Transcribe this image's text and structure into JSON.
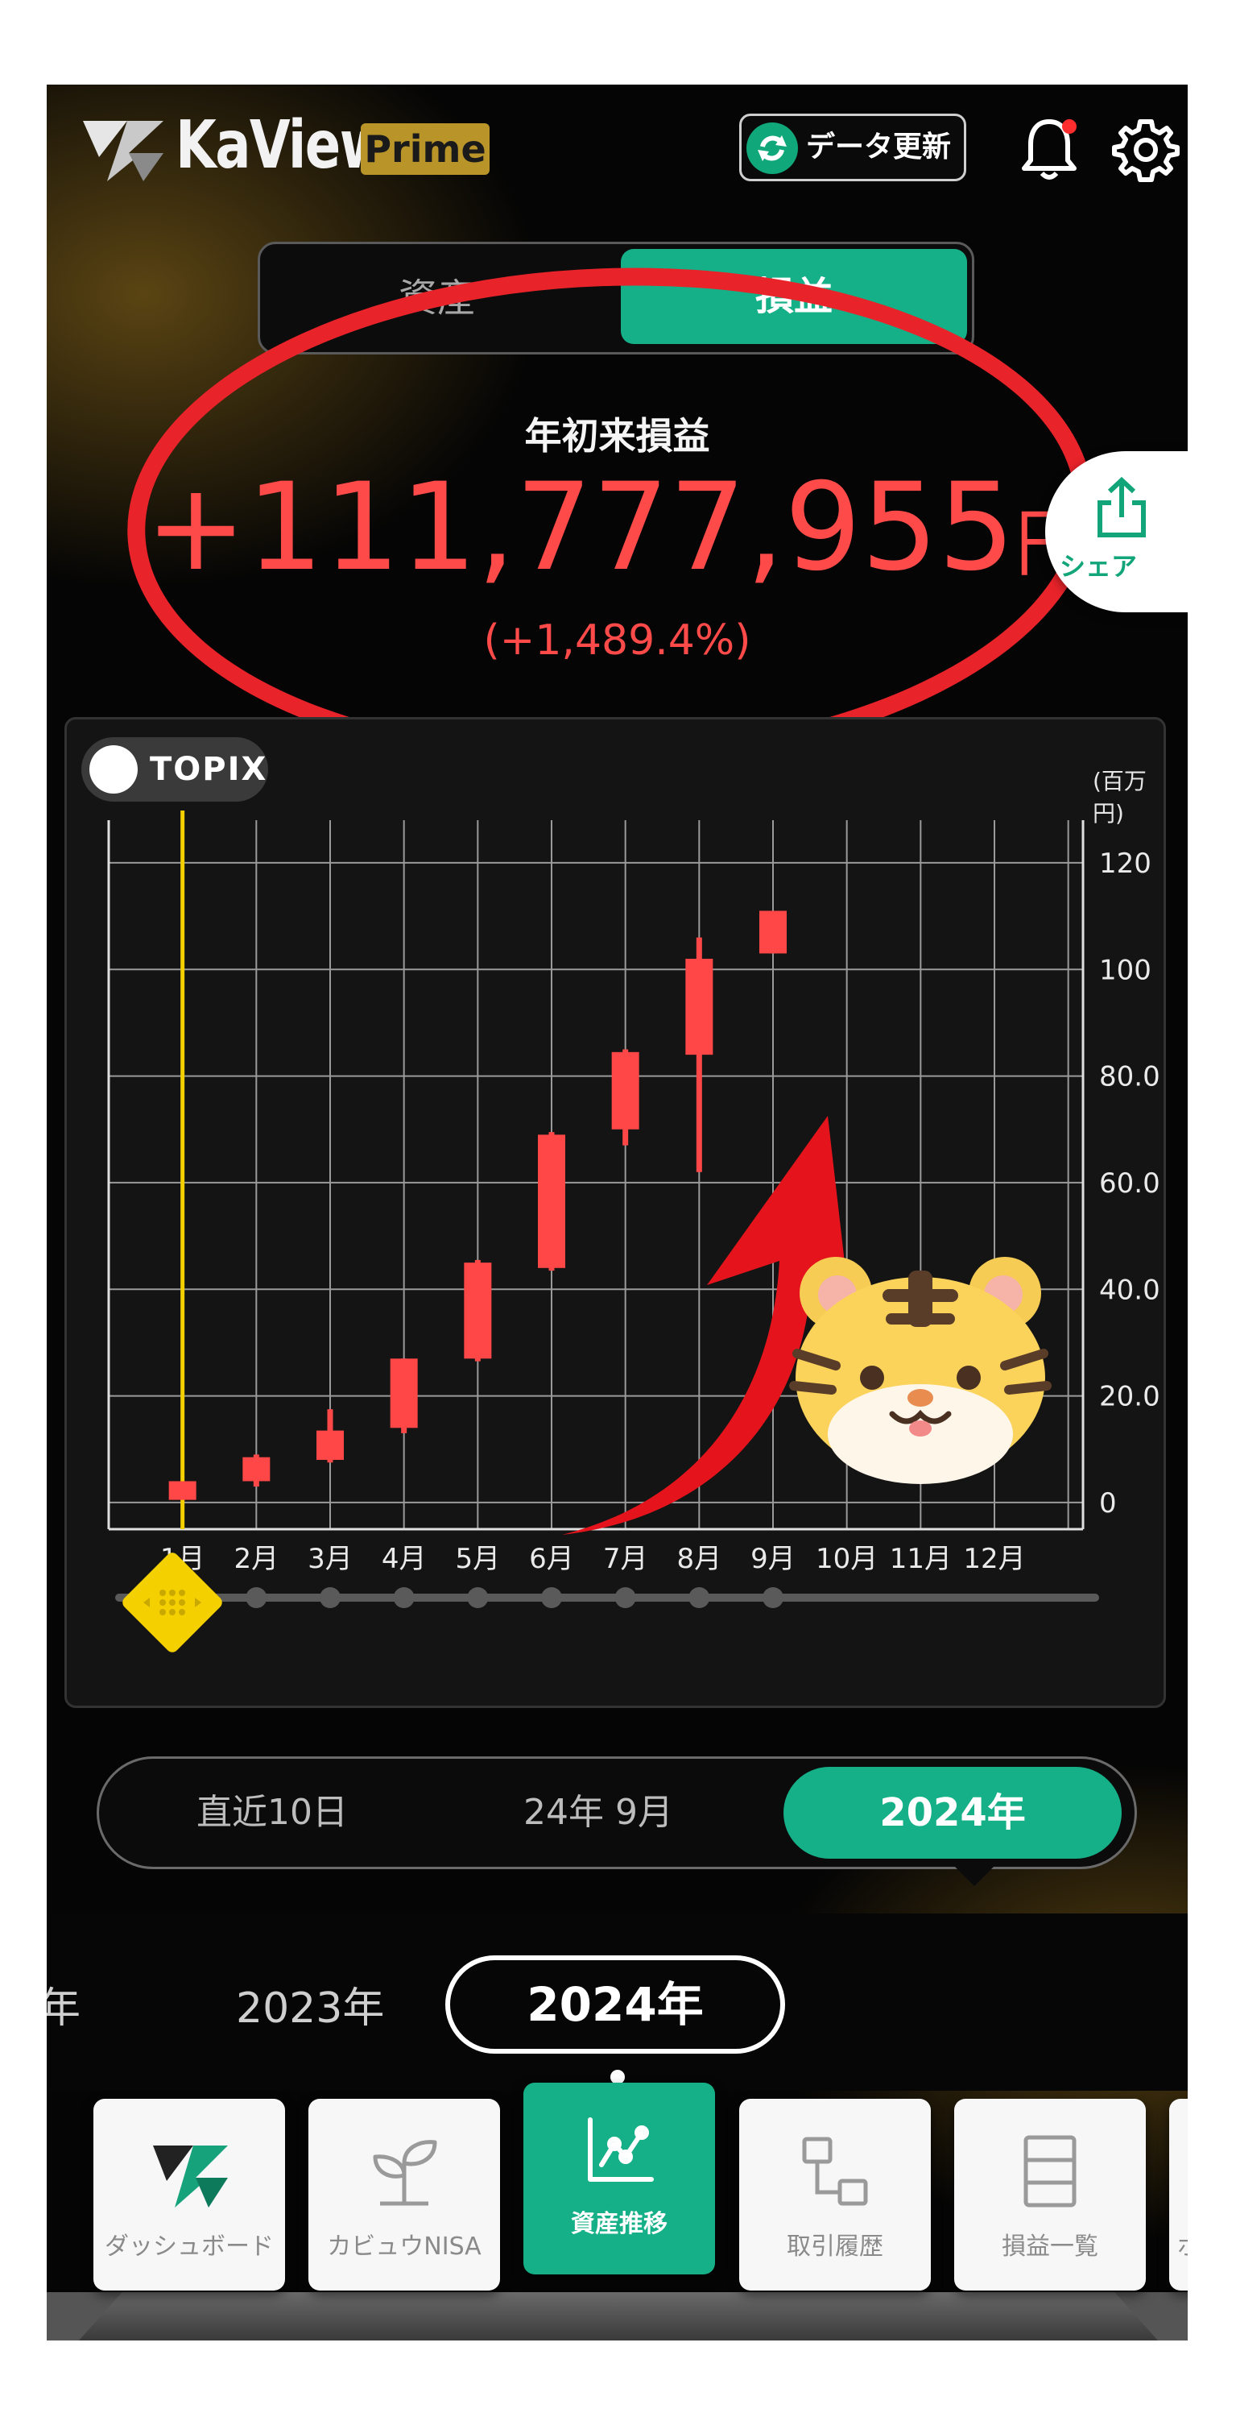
{
  "header": {
    "logo_text": "KaView",
    "logo_badge": "Prime",
    "update_label": "データ更新"
  },
  "tabs_top": {
    "asset": "資産",
    "pl": "損益",
    "active": "pl"
  },
  "summary": {
    "title": "年初来損益",
    "value": "+111,777,955",
    "currency": "円",
    "percent": "(+1,489.4%)"
  },
  "share": {
    "label": "シェア"
  },
  "chart": {
    "topix_label": "TOPIX",
    "unit_label": "(百万円)",
    "cursor_month_index": 1
  },
  "chart_data": {
    "type": "candlestick",
    "categories": [
      "1月",
      "2月",
      "3月",
      "4月",
      "5月",
      "6月",
      "7月",
      "8月",
      "9月",
      "10月",
      "11月",
      "12月"
    ],
    "y_ticks": [
      "0",
      "20.0",
      "40.0",
      "60.0",
      "80.0",
      "100",
      "120"
    ],
    "ylim": [
      -5,
      128
    ],
    "candles": [
      {
        "x": "1月",
        "open": 0.5,
        "close": 4,
        "low": 0.5,
        "high": 4
      },
      {
        "x": "2月",
        "open": 4,
        "close": 8.5,
        "low": 3,
        "high": 9
      },
      {
        "x": "3月",
        "open": 8,
        "close": 13.5,
        "low": 7.5,
        "high": 17.5
      },
      {
        "x": "4月",
        "open": 14,
        "close": 27,
        "low": 13,
        "high": 27
      },
      {
        "x": "5月",
        "open": 27,
        "close": 45,
        "low": 26.5,
        "high": 45.5
      },
      {
        "x": "6月",
        "open": 44,
        "close": 69,
        "low": 43.5,
        "high": 69.5
      },
      {
        "x": "7月",
        "open": 70,
        "close": 84.5,
        "low": 67,
        "high": 85
      },
      {
        "x": "8月",
        "open": 84,
        "close": 102,
        "low": 62,
        "high": 106
      },
      {
        "x": "9月",
        "open": 103,
        "close": 111,
        "low": 103,
        "high": 111
      }
    ],
    "grid": true,
    "colors": {
      "candle": "#ff4747",
      "cursor": "#f5d000",
      "grid": "#9a9a9a"
    }
  },
  "period_tabs": {
    "recent": "直近10日",
    "month": "24年 9月",
    "year": "2024年",
    "active": "year"
  },
  "year_strip": {
    "prev2": "年",
    "prev": "2023年",
    "current": "2024年"
  },
  "bottom_nav": {
    "dashboard": "ダッシュボード",
    "nisa": "カビュウNISA",
    "assets": "資産推移",
    "history": "取引履歴",
    "pl_list": "損益一覧",
    "more": "ポ"
  },
  "icons": [
    "logo-mark-icon",
    "sync-icon",
    "bell-icon",
    "gear-icon",
    "share-icon",
    "sprout-icon",
    "chart-line-icon",
    "transfer-icon",
    "list-icon",
    "tiger-icon",
    "arrow-icon"
  ]
}
